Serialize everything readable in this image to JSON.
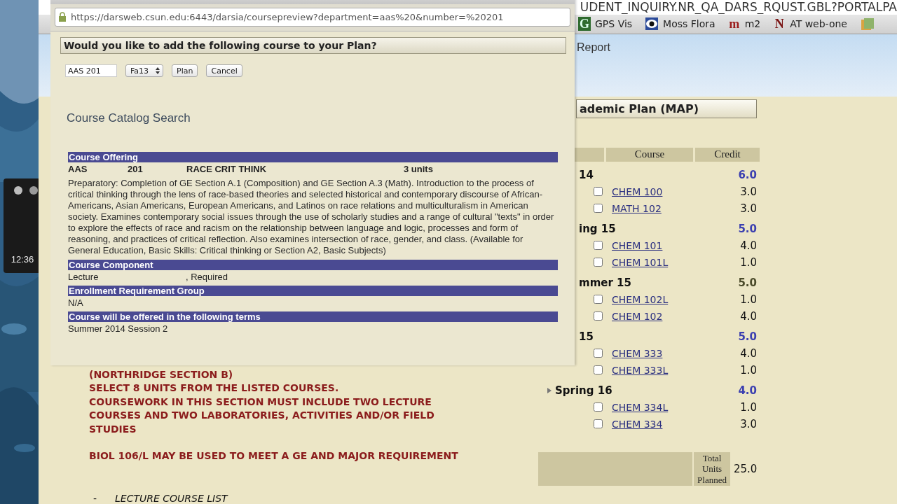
{
  "desktop": {
    "clock": "12:36"
  },
  "browser": {
    "address_fragment": "UDENT_INQUIRY.NR_QA_DARS_RQUST.GBL?PORTALPA",
    "bookmarks": [
      {
        "kind": "letter",
        "glyph": "G",
        "color": "#2f6b2f",
        "label": "GPS Vis"
      },
      {
        "kind": "eye",
        "label": "Moss Flora"
      },
      {
        "kind": "letter",
        "glyph": "m",
        "color": "#9b1c1c",
        "label": "m2"
      },
      {
        "kind": "letter",
        "glyph": "N",
        "color": "#7a1414",
        "label": "AT web-one"
      },
      {
        "kind": "folder"
      }
    ]
  },
  "page": {
    "menu_item": "Report",
    "requirements": [
      {
        "kind": "heading",
        "text": "(NORTHRIDGE SECTION B)"
      },
      {
        "kind": "heading",
        "text": "SELECT 8 UNITS FROM THE LISTED COURSES."
      },
      {
        "kind": "heading",
        "text": "COURSEWORK IN THIS SECTION MUST INCLUDE TWO LECTURE COURSES AND TWO LABORATORIES, ACTIVITIES AND/OR FIELD STUDIES"
      },
      {
        "kind": "note",
        "text": "BIOL 106/L MAY BE USED TO MEET A GE AND MAJOR REQUIREMENT"
      },
      {
        "kind": "list",
        "bullet": "-",
        "text": "LECTURE COURSE LIST"
      }
    ]
  },
  "plan": {
    "title": "ademic Plan (MAP)",
    "columns": [
      "Course",
      "Credit"
    ],
    "terms": [
      {
        "label": "14",
        "arrow": false,
        "credit": "6.0",
        "color": "#3b3fb0",
        "courses": [
          {
            "code": "CHEM 100",
            "credit": "3.0",
            "checked": false
          },
          {
            "code": "MATH 102",
            "credit": "3.0",
            "checked": false
          }
        ]
      },
      {
        "label": "ing 15",
        "arrow": false,
        "credit": "5.0",
        "color": "#3b3fb0",
        "courses": [
          {
            "code": "CHEM 101",
            "credit": "4.0",
            "checked": false
          },
          {
            "code": "CHEM 101L",
            "credit": "1.0",
            "checked": false
          }
        ]
      },
      {
        "label": "mmer 15",
        "arrow": false,
        "credit": "5.0",
        "color": "#4a4a2a",
        "courses": [
          {
            "code": "CHEM 102L",
            "credit": "1.0",
            "checked": false
          },
          {
            "code": "CHEM 102",
            "credit": "4.0",
            "checked": false
          }
        ]
      },
      {
        "label": "15",
        "arrow": false,
        "credit": "5.0",
        "color": "#3b3fb0",
        "courses": [
          {
            "code": "CHEM 333",
            "credit": "4.0",
            "checked": false
          },
          {
            "code": "CHEM 333L",
            "credit": "1.0",
            "checked": false
          }
        ]
      },
      {
        "label": "Spring 16",
        "arrow": true,
        "credit": "4.0",
        "color": "#3b3fb0",
        "courses": [
          {
            "code": "CHEM 334L",
            "credit": "1.0",
            "checked": false
          },
          {
            "code": "CHEM 334",
            "credit": "3.0",
            "checked": false
          }
        ]
      }
    ],
    "total_label": "Total Units Planned",
    "total": "25.0"
  },
  "popup": {
    "url": "https://darsweb.csun.edu:6443/darsia/coursepreview?department=aas%20&number=%20201",
    "question": "Would you like to add the following course to your Plan?",
    "course_field": "AAS 201",
    "term_select": "Fa13",
    "buttons": [
      "Plan",
      "Cancel"
    ],
    "heading": "Course Catalog Search",
    "sections": [
      {
        "kind": "offering",
        "title": "Course Offering",
        "cells": [
          "AAS",
          "201",
          "RACE CRIT THINK",
          "3 units"
        ],
        "description": "Preparatory: Completion of GE Section A.1 (Composition) and GE Section A.3 (Math). Introduction to the process of critical thinking through the lens of race-based theories and selected historical and contemporary discourse of African-Americans, Asian Americans, European Americans, and Latinos on race relations and multiculturalism in American society. Examines contemporary social issues through the use of scholarly studies and a range of cultural \"texts\" in order to explore the effects of race and racism on the relationship between language and logic, processes and form of reasoning, and practices of critical reflection. Also examines intersection of race, gender, and class. (Available for General Education, Basic Skills: Critical thinking or Section A2, Basic Subjects)"
      },
      {
        "kind": "plain",
        "title": "Course Component",
        "cells": [
          "Lecture",
          ", Required"
        ]
      },
      {
        "kind": "plain",
        "title": "Enrollment Requirement Group",
        "cells": [
          "N/A"
        ]
      },
      {
        "kind": "plain",
        "title": "Course will be offered in the following terms",
        "cells": [
          "Summer 2014 Session 2"
        ]
      }
    ]
  }
}
